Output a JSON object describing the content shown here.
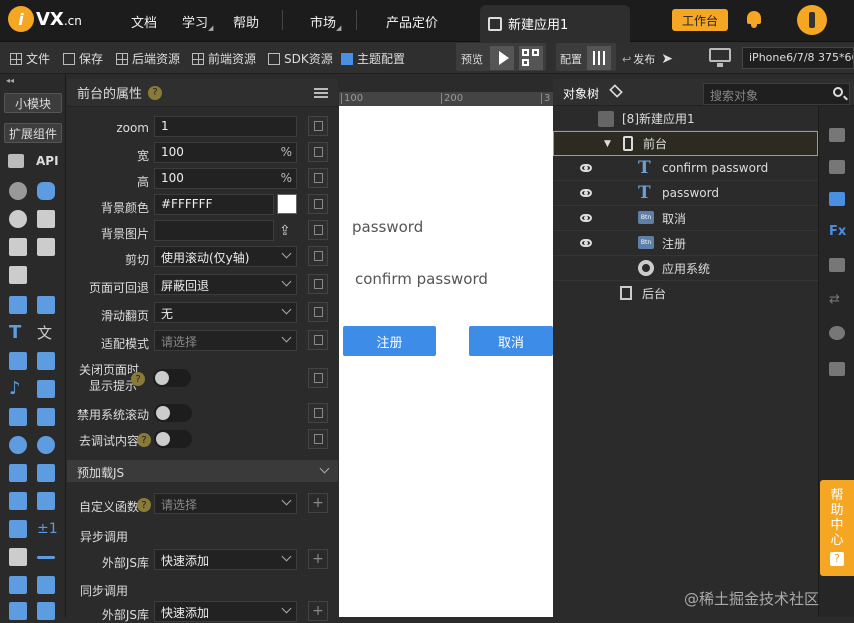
{
  "brand": {
    "logo_letter": "i",
    "name": "VX",
    "domain": ".cn"
  },
  "topnav": {
    "items": [
      "文档",
      "学习",
      "帮助",
      "市场",
      "产品定价"
    ],
    "app_tab": "新建应用1",
    "workbench": "工作台"
  },
  "toolbar": {
    "file": "文件",
    "save": "保存",
    "backend": "后端资源",
    "frontend": "前端资源",
    "sdk": "SDK资源",
    "theme": "主题配置",
    "preview": "预览",
    "config": "配置",
    "publish": "发布",
    "device": "iPhone6/7/8 375*66"
  },
  "leftstrip": {
    "small_module": "小模块",
    "ext_components": "扩展组件",
    "api": "API"
  },
  "props": {
    "title": "前台的属性",
    "help": "?",
    "fields": [
      {
        "label": "zoom",
        "value": "1",
        "unit": ""
      },
      {
        "label": "宽",
        "value": "100",
        "unit": "%"
      },
      {
        "label": "高",
        "value": "100",
        "unit": "%"
      },
      {
        "label": "背景颜色",
        "value": "#FFFFFF",
        "unit": ""
      },
      {
        "label": "背景图片",
        "value": "",
        "unit": ""
      },
      {
        "label": "剪切",
        "value": "使用滚动(仅y轴)",
        "unit": ""
      },
      {
        "label": "页面可回退",
        "value": "屏蔽回退",
        "unit": ""
      },
      {
        "label": "滑动翻页",
        "value": "无",
        "unit": ""
      },
      {
        "label": "适配模式",
        "value": "请选择",
        "unit": ""
      }
    ],
    "toggles": [
      {
        "label_line1": "关闭页面时",
        "label_line2": "显示提示"
      },
      {
        "label_line1": "禁用系统滚动",
        "label_line2": ""
      },
      {
        "label_line1": "去调试内容",
        "label_line2": ""
      }
    ],
    "preload_section": "预加载JS",
    "custom_func_label": "自定义函数",
    "custom_func_placeholder": "请选择",
    "async_call": "异步调用",
    "ext_js_label": "外部JS库",
    "ext_js_value": "快速添加",
    "sync_call": "同步调用",
    "ext_js_label2": "外部JS库",
    "ext_js_value2": "快速添加"
  },
  "ruler": {
    "ticks": [
      "100",
      "200",
      "3"
    ]
  },
  "canvas": {
    "password": "password",
    "confirm_password": "confirm password",
    "register_btn": "注册",
    "cancel_btn": "取消"
  },
  "tree": {
    "title": "对象树",
    "search_placeholder": "搜索对象",
    "rows": [
      {
        "label": "[8]新建应用1",
        "icon": "app-icon",
        "eye": false
      },
      {
        "label": "前台",
        "icon": "phone-icon",
        "eye": false
      },
      {
        "label": "confirm password",
        "icon": "text-icon",
        "eye": true
      },
      {
        "label": "password",
        "icon": "text-icon",
        "eye": true
      },
      {
        "label": "取消",
        "icon": "button-icon",
        "eye": true
      },
      {
        "label": "注册",
        "icon": "button-icon",
        "eye": true
      },
      {
        "label": "应用系统",
        "icon": "gear-icon",
        "eye": false
      },
      {
        "label": "后台",
        "icon": "server-icon",
        "eye": false
      }
    ]
  },
  "help": {
    "text": "帮助中心",
    "q": "?"
  },
  "watermark": "@稀土掘金技术社区",
  "colors": {
    "accent": "#f5a623",
    "button": "#3d8ce8",
    "panel": "#2b2b2b"
  }
}
